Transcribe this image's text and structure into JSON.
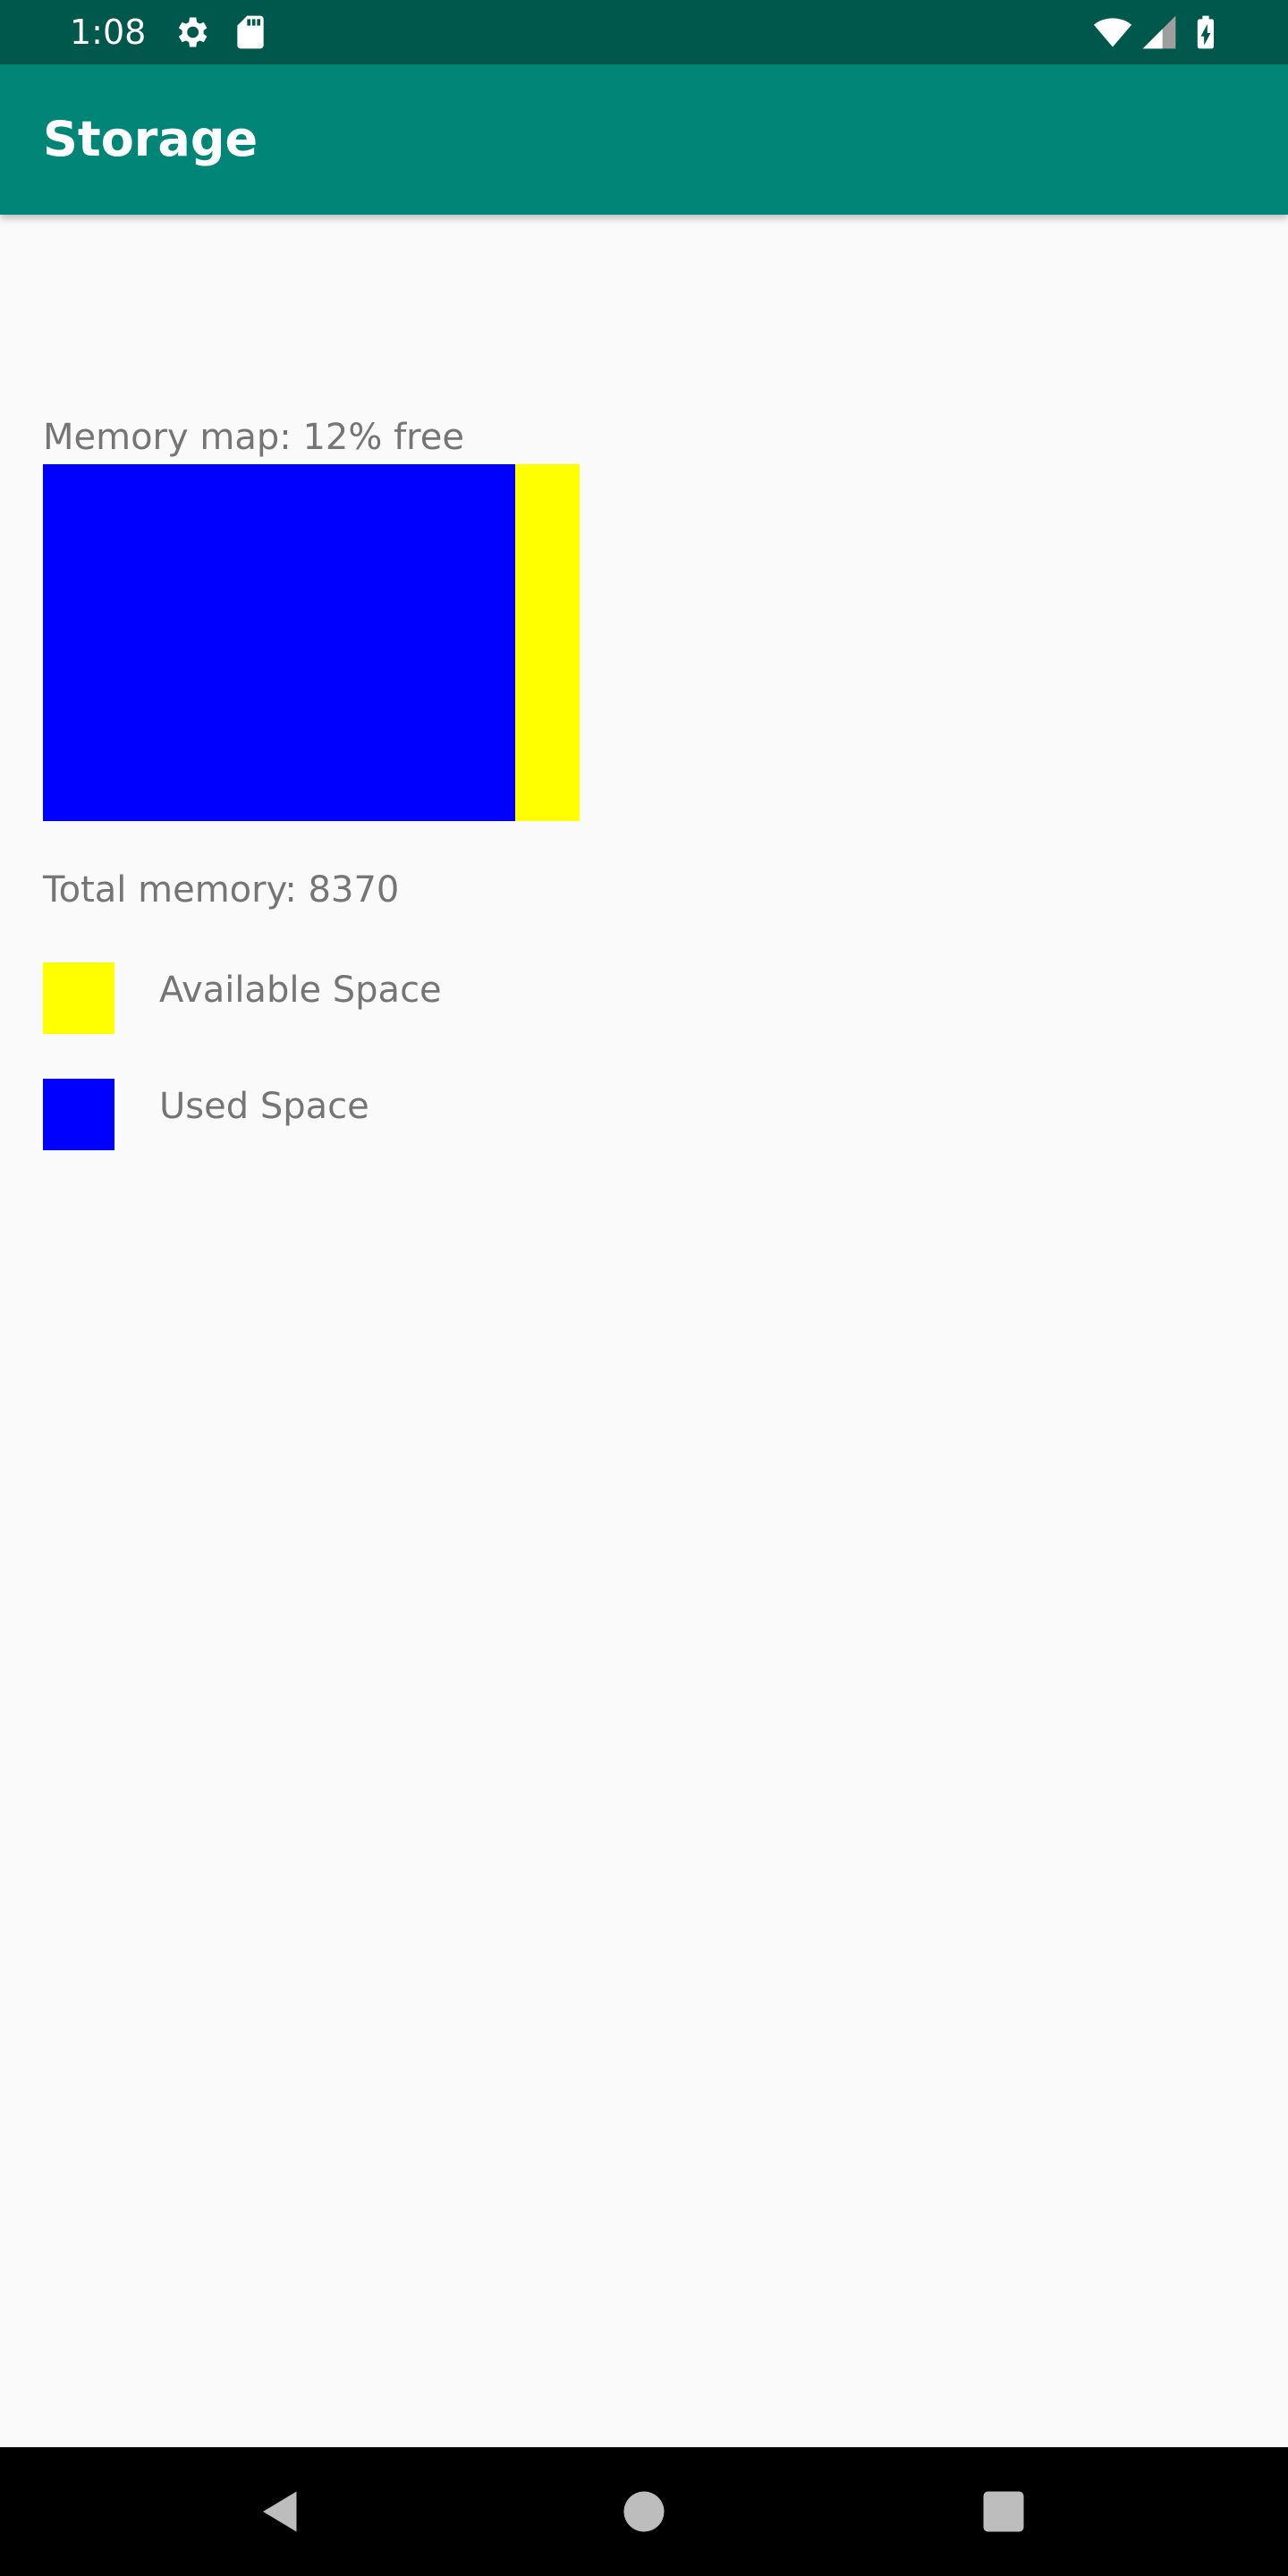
{
  "status_bar": {
    "time": "1:08",
    "icons": [
      "gear-icon",
      "sd-card-icon",
      "wifi-icon",
      "cell-signal-icon",
      "battery-charging-icon"
    ]
  },
  "app_bar": {
    "title": "Storage"
  },
  "memory": {
    "map_label": "Memory map: 12% free",
    "free_percent": 12,
    "used_percent": 88,
    "total_label": "Total memory: 8370"
  },
  "legend": {
    "available_label": "Available Space",
    "used_label": "Used Space"
  },
  "colors": {
    "status_bar": "#00574B",
    "app_bar": "#008577",
    "used": "#0000FF",
    "available": "#FFFF00",
    "text_secondary": "#757575",
    "background": "#FAFAFA"
  },
  "nav_bar": {
    "buttons": [
      "back-icon",
      "home-icon",
      "recents-icon"
    ]
  }
}
